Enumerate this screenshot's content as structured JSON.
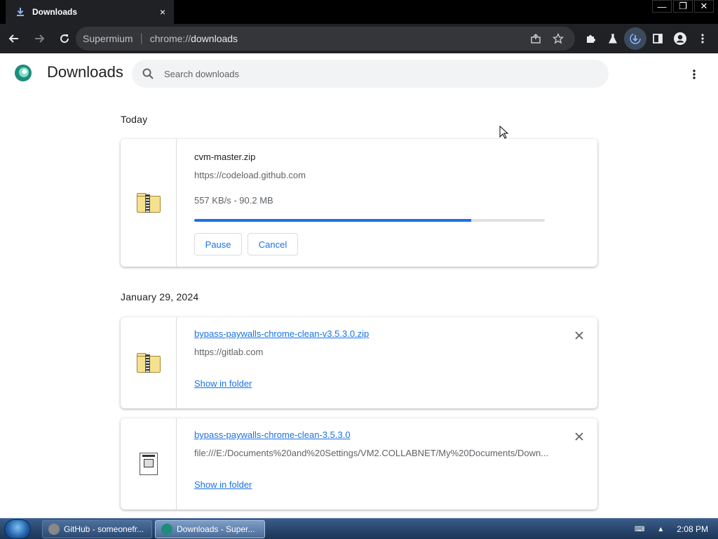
{
  "browser": {
    "tab_title": "Downloads",
    "tab_close": "×",
    "window_controls": [
      "—",
      "❐",
      "✕"
    ],
    "omnibox": {
      "site_name": "Supermium",
      "separator": "|",
      "url_scheme": "chrome://",
      "url_host": "downloads"
    }
  },
  "page": {
    "title": "Downloads",
    "search_placeholder": "Search downloads"
  },
  "sections": [
    {
      "date": "Today",
      "items": [
        {
          "file_name": "cvm-master.zip",
          "url": "https://codeload.github.com",
          "status": "557 KB/s - 90.2 MB",
          "progress": 0.79,
          "pause_label": "Pause",
          "cancel_label": "Cancel"
        }
      ]
    },
    {
      "date": "January 29, 2024",
      "items": [
        {
          "file_name": "bypass-paywalls-chrome-clean-v3.5.3.0.zip",
          "url": "https://gitlab.com",
          "action_label": "Show in folder"
        },
        {
          "file_name": "bypass-paywalls-chrome-clean-3.5.3.0",
          "url": "file:///E:/Documents%20and%20Settings/VM2.COLLABNET/My%20Documents/Down...",
          "action_label": "Show in folder"
        }
      ]
    }
  ],
  "taskbar": {
    "items": [
      {
        "label": "GitHub - someonefr..."
      },
      {
        "label": "Downloads - Super..."
      }
    ],
    "clock": "2:08 PM"
  },
  "colors": {
    "accent": "#1a73e8",
    "toolbar": "#202124",
    "titlebar": "#000000"
  }
}
